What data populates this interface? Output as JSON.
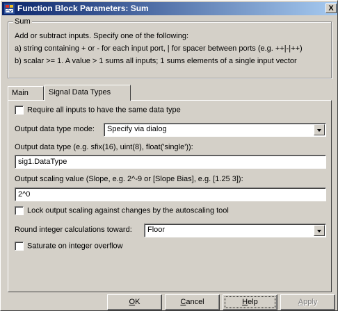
{
  "window": {
    "title": "Function Block Parameters: Sum",
    "close_glyph": "X"
  },
  "group": {
    "legend": "Sum",
    "description_lines": [
      "Add or subtract inputs.  Specify one of the following:",
      "a) string containing + or - for each input port, | for spacer between ports (e.g. ++|-|++)",
      "b) scalar >= 1. A value > 1 sums all inputs; 1 sums elements of a single input vector"
    ]
  },
  "tabs": [
    {
      "label": "Main",
      "active": false
    },
    {
      "label": "Signal Data Types",
      "active": true
    }
  ],
  "params": {
    "require_same_type": {
      "label": "Require all inputs to have the same data type",
      "checked": false
    },
    "output_mode": {
      "label": "Output data type mode:",
      "value": "Specify via dialog"
    },
    "output_type": {
      "label": "Output data type (e.g. sfix(16), uint(8), float('single')):",
      "value": "sig1.DataType"
    },
    "output_scaling": {
      "label": "Output scaling value (Slope, e.g. 2^-9 or [Slope Bias], e.g. [1.25 3]):",
      "value": "2^0"
    },
    "lock_scaling": {
      "label": "Lock output scaling against changes by the autoscaling tool",
      "checked": false
    },
    "round_toward": {
      "label": "Round integer calculations toward:",
      "value": "Floor"
    },
    "saturate": {
      "label": "Saturate on integer overflow",
      "checked": false
    }
  },
  "buttons": {
    "ok": {
      "mnemonic": "O",
      "rest": "K"
    },
    "cancel": {
      "mnemonic": "C",
      "rest": "ancel"
    },
    "help": {
      "mnemonic": "H",
      "rest": "elp"
    },
    "apply": {
      "mnemonic": "A",
      "rest": "pply"
    }
  },
  "colors": {
    "dialog_bg": "#d4d0c8",
    "titlebar_start": "#0a246a",
    "titlebar_end": "#a6caf0",
    "disabled_text": "#808080"
  }
}
